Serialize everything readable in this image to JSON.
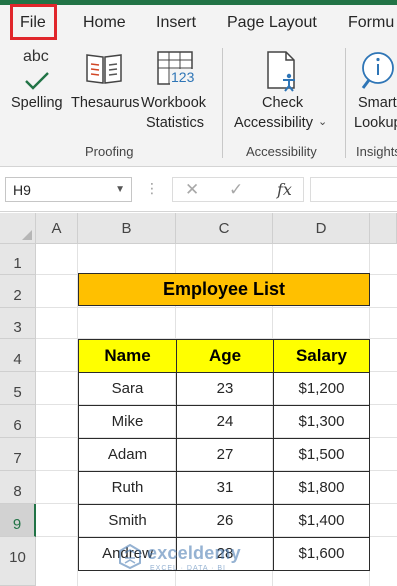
{
  "ribbon_tabs": [
    "File",
    "Home",
    "Insert",
    "Page Layout",
    "Formu"
  ],
  "groups": {
    "proofing": {
      "label": "Proofing",
      "spelling_icon_text": "abc",
      "spelling": "Spelling",
      "thesaurus": "Thesaurus",
      "workbook_line1": "Workbook",
      "workbook_line2": "Statistics",
      "workbook_icon_digits": "123"
    },
    "accessibility": {
      "label": "Accessibility",
      "check_line1": "Check",
      "check_line2": "Accessibility"
    },
    "insights": {
      "label": "Insights",
      "smart_line1": "Smart",
      "smart_line2": "Lookup"
    }
  },
  "formula_bar": {
    "name_box": "H9",
    "fx_label": "fx",
    "formula": ""
  },
  "sheet": {
    "columns": [
      "A",
      "B",
      "C",
      "D"
    ],
    "rows": [
      "1",
      "2",
      "3",
      "4",
      "5",
      "6",
      "7",
      "8",
      "9",
      "10"
    ],
    "selected_row": "9",
    "title": "Employee List",
    "table": {
      "headers": [
        "Name",
        "Age",
        "Salary"
      ],
      "rows": [
        [
          "Sara",
          "23",
          "$1,200"
        ],
        [
          "Mike",
          "24",
          "$1,300"
        ],
        [
          "Adam",
          "27",
          "$1,500"
        ],
        [
          "Ruth",
          "31",
          "$1,800"
        ],
        [
          "Smith",
          "26",
          "$1,400"
        ],
        [
          "Andrew",
          "28",
          "$1,600"
        ]
      ]
    }
  },
  "watermark": {
    "name": "exceldemy",
    "tagline": "EXCEL · DATA · BI"
  },
  "colors": {
    "excel_green": "#217346",
    "file_highlight": "#e0262b",
    "title_fill": "#ffc000",
    "header_fill": "#ffff00"
  }
}
